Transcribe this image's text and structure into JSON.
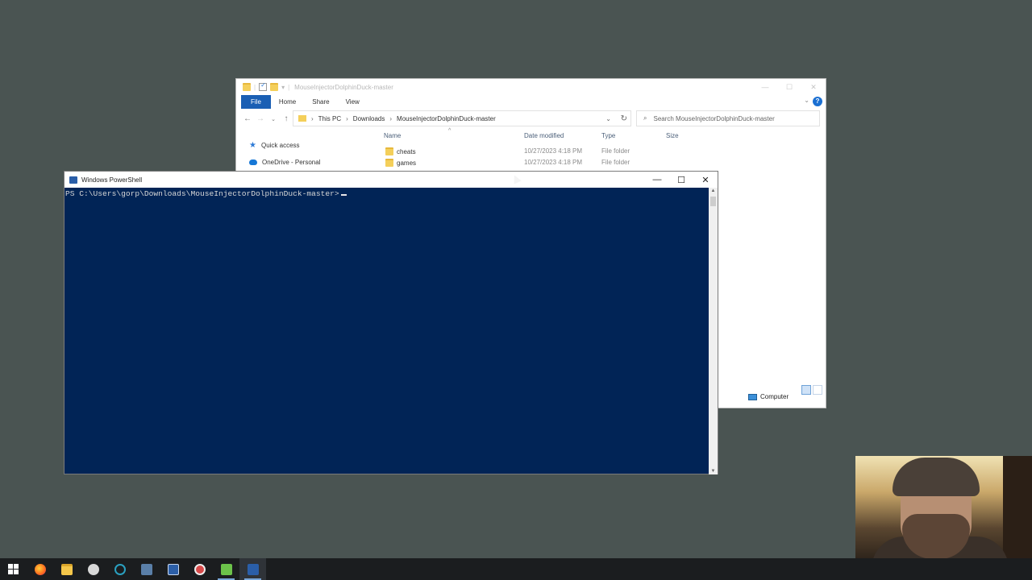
{
  "explorer": {
    "title": "MouseInjectorDolphinDuck-master",
    "ribbon_tabs": [
      "File",
      "Home",
      "Share",
      "View"
    ],
    "help_label": "?",
    "breadcrumbs": [
      "This PC",
      "Downloads",
      "MouseInjectorDolphinDuck-master"
    ],
    "search_placeholder": "Search MouseInjectorDolphinDuck-master",
    "sidebar": [
      {
        "label": "Quick access",
        "icon": "star-icon"
      },
      {
        "label": "OneDrive - Personal",
        "icon": "cloud-icon"
      }
    ],
    "columns": {
      "name": "Name",
      "date": "Date modified",
      "type": "Type",
      "size": "Size"
    },
    "files": [
      {
        "name": "cheats",
        "date": "10/27/2023 4:18 PM",
        "type": "File folder",
        "size": ""
      },
      {
        "name": "games",
        "date": "10/27/2023 4:18 PM",
        "type": "File folder",
        "size": ""
      }
    ],
    "status_location": "Computer"
  },
  "powershell": {
    "title": "Windows PowerShell",
    "prompt": "PS C:\\Users\\gorp\\Downloads\\MouseInjectorDolphinDuck-master>"
  },
  "taskbar": {
    "items": [
      "start-icon",
      "firefox-icon",
      "file-explorer-icon",
      "app-icon",
      "app-icon-2",
      "calculator-icon",
      "notepad-icon",
      "app-icon-3",
      "app-icon-4",
      "powershell-icon"
    ]
  },
  "colors": {
    "desktop": "#4a5452",
    "powershell_bg": "#012456",
    "ribbon_file": "#1a5fb4"
  }
}
